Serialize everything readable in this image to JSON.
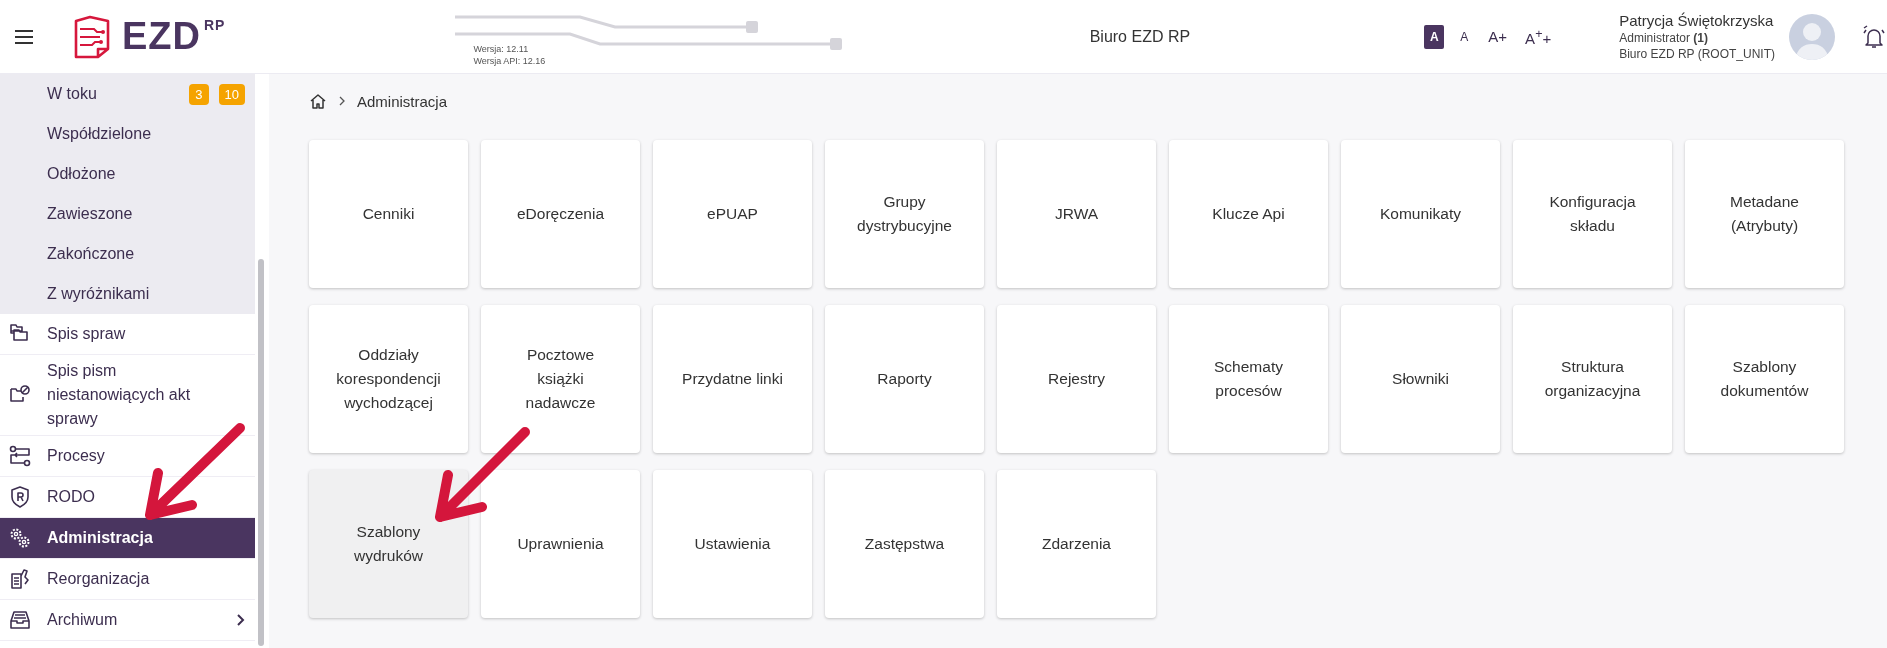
{
  "header": {
    "logo": {
      "text": "EZD",
      "superscript": "RP"
    },
    "versions": [
      "Wersja: 12.11",
      "Wersja API: 12.16"
    ],
    "title": "Biuro EZD RP",
    "font_sizes": [
      {
        "label": "A",
        "selected": true
      },
      {
        "label": "A",
        "selected": false
      },
      {
        "label": "A+",
        "selected": false
      },
      {
        "label": "A$^{+}$+",
        "selected": false
      }
    ],
    "user": {
      "name": "Patrycja Świętokrzyska",
      "role": "Administrator **(1)**",
      "unit": "Biuro EZD RP (ROOT_UNIT)"
    }
  },
  "sidebar": {
    "items": [
      {
        "kind": "sub",
        "label": "W toku",
        "selected": false,
        "badges": [
          "3",
          "10"
        ]
      },
      {
        "kind": "sub",
        "label": "Współdzielone",
        "selected": false
      },
      {
        "kind": "sub",
        "label": "Odłożone",
        "selected": false
      },
      {
        "kind": "sub",
        "label": "Zawieszone",
        "selected": false
      },
      {
        "kind": "sub",
        "label": "Zakończone",
        "selected": false
      },
      {
        "kind": "sub",
        "label": "Z wyróżnikami",
        "selected": false
      },
      {
        "kind": "item",
        "label": "Spis spraw",
        "selected": false
      },
      {
        "kind": "item",
        "label": "Spis pism niestanowiących akt sprawy",
        "selected": false
      },
      {
        "kind": "item",
        "label": "Procesy",
        "selected": false
      },
      {
        "kind": "item",
        "label": "RODO",
        "selected": false
      },
      {
        "kind": "item",
        "label": "Administracja",
        "selected": true
      },
      {
        "kind": "item",
        "label": "Reorganizacja",
        "selected": false
      },
      {
        "kind": "group",
        "label": "Archiwum",
        "selected": false
      }
    ]
  },
  "breadcrumb": [
    "Administracja"
  ],
  "tiles": [
    {
      "label": "Cenniki",
      "selected": false
    },
    {
      "label": "eDoręczenia",
      "selected": false
    },
    {
      "label": "ePUAP",
      "selected": false
    },
    {
      "label": "Grupy dystrybucyjne",
      "selected": false
    },
    {
      "label": "JRWA",
      "selected": false
    },
    {
      "label": "Klucze Api",
      "selected": false
    },
    {
      "label": "Komunikaty",
      "selected": false
    },
    {
      "label": "Konfiguracja składu",
      "selected": false
    },
    {
      "label": "Metadane (Atrybuty)",
      "selected": false
    },
    {
      "label": "Oddziały korespondencji wychodzącej",
      "selected": false
    },
    {
      "label": "Pocztowe książki nadawcze",
      "selected": false
    },
    {
      "label": "Przydatne linki",
      "selected": false
    },
    {
      "label": "Raporty",
      "selected": false
    },
    {
      "label": "Rejestry",
      "selected": false
    },
    {
      "label": "Schematy procesów",
      "selected": false
    },
    {
      "label": "Słowniki",
      "selected": false
    },
    {
      "label": "Struktura organizacyjna",
      "selected": false
    },
    {
      "label": "Szablony dokumentów",
      "selected": false
    },
    {
      "label": "Szablony wydruków",
      "selected": true
    },
    {
      "label": "Uprawnienia",
      "selected": false
    },
    {
      "label": "Ustawienia",
      "selected": false
    },
    {
      "label": "Zastępstwa",
      "selected": false
    },
    {
      "label": "Zdarzenia",
      "selected": false
    }
  ]
}
